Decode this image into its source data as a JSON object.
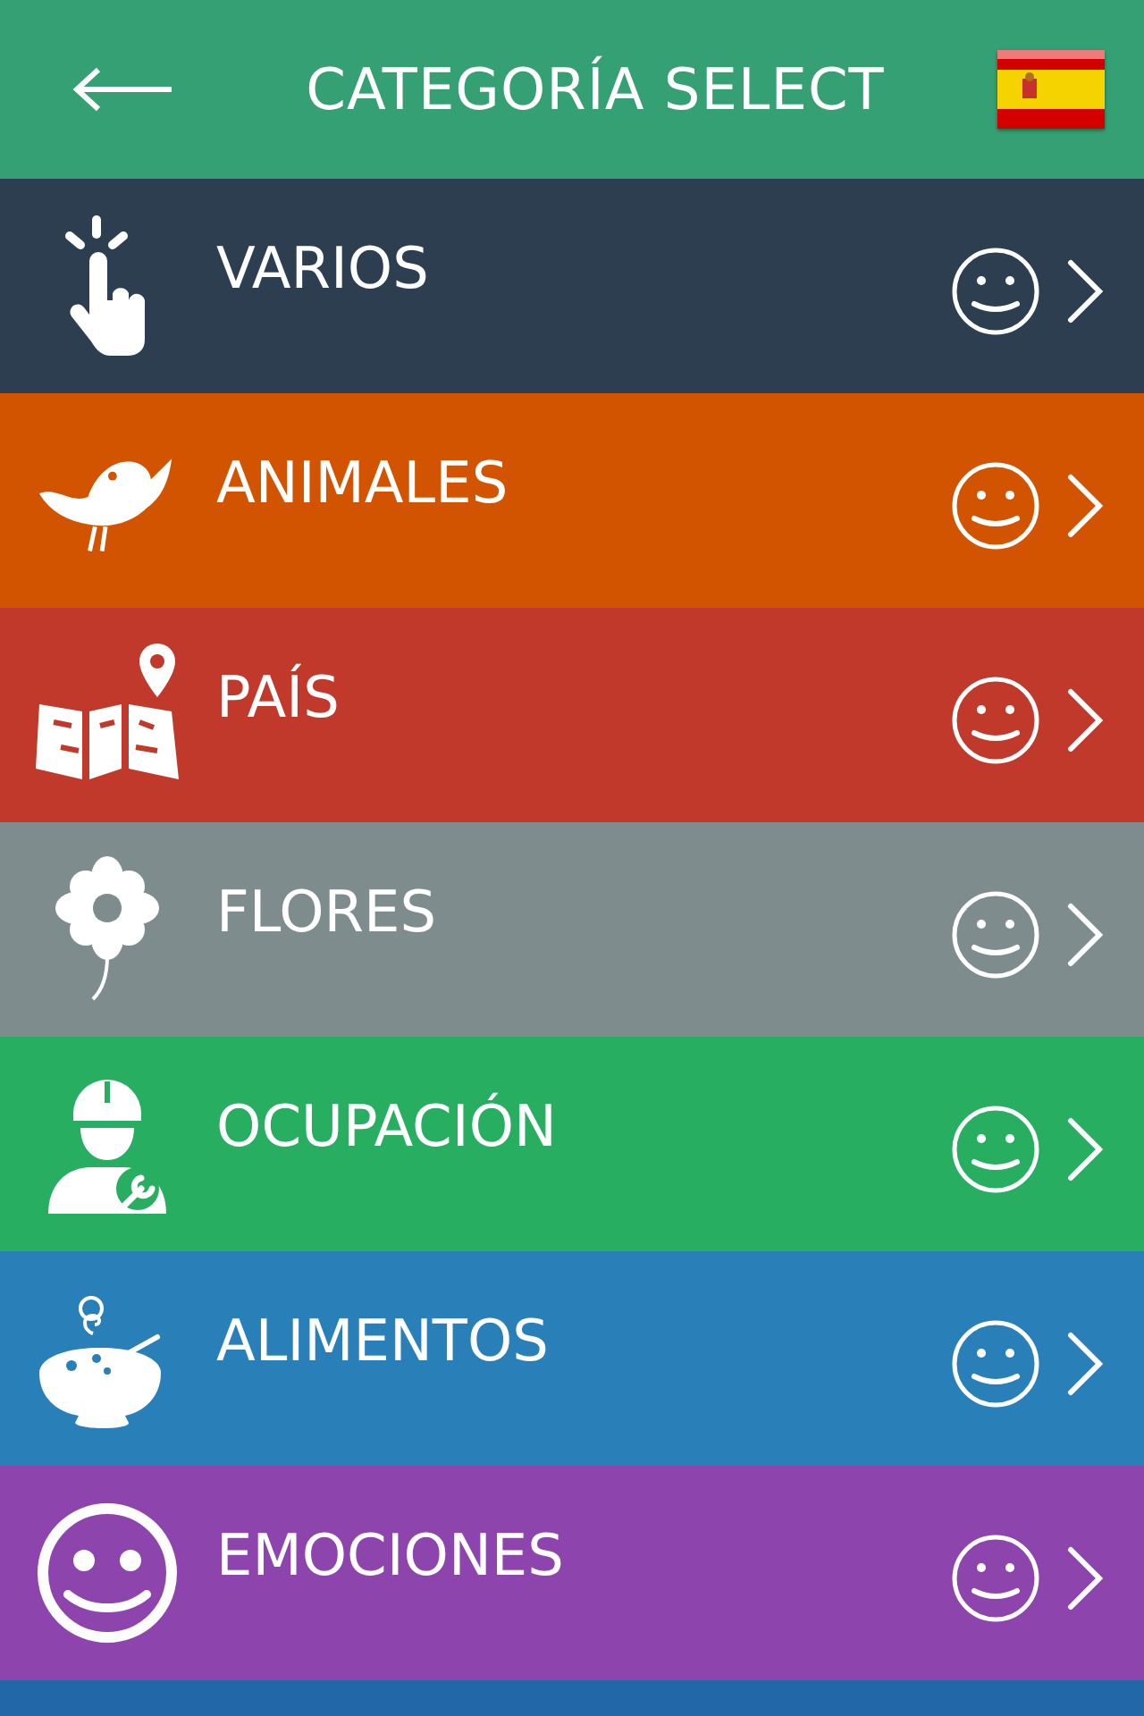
{
  "header": {
    "title": "CATEGORÍA SELECT"
  },
  "categories": [
    {
      "label": "VARIOS",
      "kind": "touch",
      "color": "#2c3e50"
    },
    {
      "label": "ANIMALES",
      "kind": "bird",
      "color": "#d35400"
    },
    {
      "label": "PAÍS",
      "kind": "map",
      "color": "#c0392b"
    },
    {
      "label": "FLORES",
      "kind": "flower",
      "color": "#7f8c8d"
    },
    {
      "label": "OCUPACIÓN",
      "kind": "worker",
      "color": "#27ae60"
    },
    {
      "label": "ALIMENTOS",
      "kind": "food",
      "color": "#2980b9"
    },
    {
      "label": "EMOCIONES",
      "kind": "smiley",
      "color": "#8e44ad"
    }
  ]
}
